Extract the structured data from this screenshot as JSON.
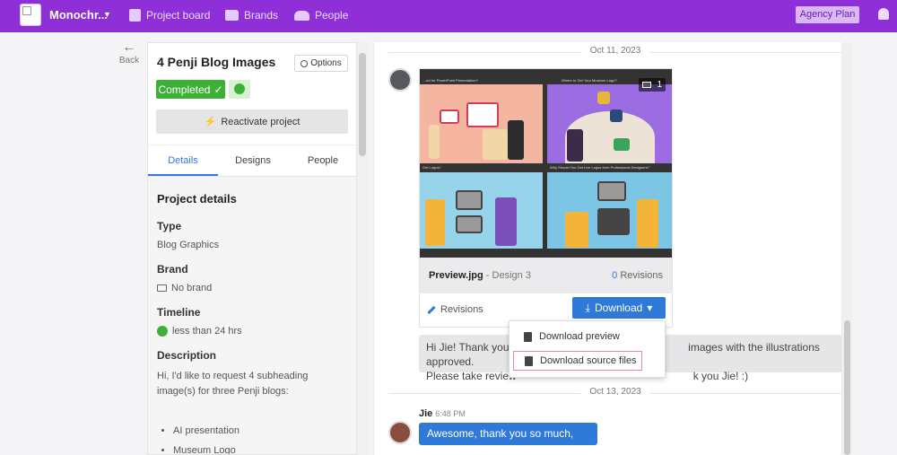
{
  "topbar": {
    "workspace": "Monochr...",
    "nav": [
      {
        "label": "Project board",
        "icon": "clipboard-icon"
      },
      {
        "label": "Brands",
        "icon": "folder-icon"
      },
      {
        "label": "People",
        "icon": "people-icon"
      }
    ],
    "plan_label": "Agency Plan",
    "colors": {
      "bar": "#8e2fd8"
    }
  },
  "back_label": "Back",
  "project": {
    "title": "4 Penji Blog Images",
    "options_label": "Options",
    "status_label": "Completed",
    "reactivate_label": "Reactivate project",
    "tabs": [
      "Details",
      "Designs",
      "People"
    ],
    "details_title": "Project details",
    "type_label": "Type",
    "type_value": "Blog Graphics",
    "brand_label": "Brand",
    "brand_value": "No brand",
    "timeline_label": "Timeline",
    "timeline_value": "less than 24 hrs",
    "description_label": "Description",
    "description_text": "Hi, I'd like to request 4 subheading image(s) for three Penji blogs:",
    "bullets": [
      "AI presentation",
      "Museum Logo"
    ]
  },
  "chat": {
    "date1": "Oct 11, 2023",
    "date2": "Oct 13, 2023",
    "design": {
      "copies": "1",
      "captions": [
        "...ool for PowerPoint Presentation?",
        "Where to Get Your Museum Logo?",
        "Get Logos?",
        "Why Should You Get Live Logos from Professional Designers?"
      ],
      "filename": "Preview.jpg",
      "design_label": "- Design 3",
      "revisions_count": "0",
      "revisions_word": "Revisions",
      "revisions_link": "Revisions",
      "download_label": "Download"
    },
    "message1_line1": "Hi Jie! Thank you f",
    "message1_line1_end": "images with the illustrations approved.",
    "message1_line2": "Please take review",
    "message1_line2_end": "k you Jie! :)",
    "dropdown": {
      "item1": "Download preview",
      "item2": "Download source files"
    },
    "sender_name": "Jie",
    "sender_time": "6:48 PM",
    "message2": "Awesome, thank you so much, Fajar!"
  }
}
